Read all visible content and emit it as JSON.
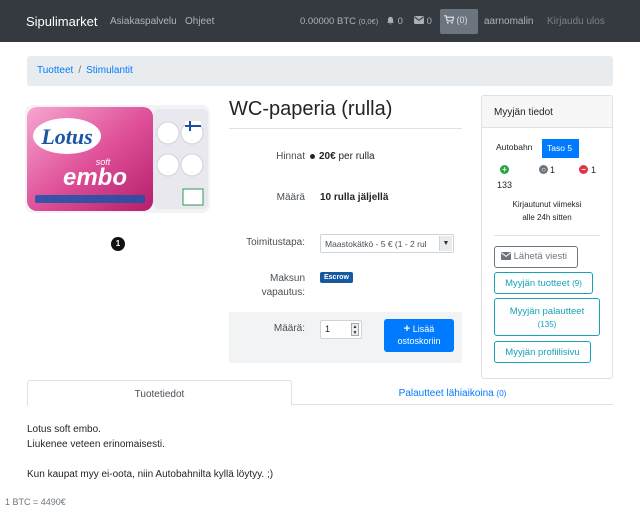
{
  "navbar": {
    "brand": "Sipulimarket",
    "links": [
      "Asiakaspalvelu",
      "Ohjeet"
    ],
    "balance": "0.00000 BTC",
    "balance_eur": "(0,0€)",
    "notifications": "0",
    "messages": "0",
    "cart_count": "(0)",
    "username": "aarnomalin",
    "logout": "Kirjaudu ulos",
    "icons": [
      "bell-icon",
      "envelope-icon",
      "cart-icon"
    ]
  },
  "breadcrumb": [
    "Tuotteet",
    "Stimulantit"
  ],
  "product": {
    "image_badge": "1",
    "title": "WC-paperia (rulla)",
    "price_label": "Hinnat",
    "price_value": "20€",
    "price_unit": "per rulla",
    "stock_label": "Määrä",
    "stock_value": "10 rulla jäljellä",
    "shipping_label": "Toimitustapa:",
    "shipping_selected": "Maastokätkö - 5 € (1 - 2 rul",
    "payment_label_1": "Maksun",
    "payment_label_2": "vapautus:",
    "payment_badge": "Escrow",
    "quantity_label": "Määrä:",
    "quantity_value": "1",
    "add_to_cart_1": "Lisää",
    "add_to_cart_2": "ostoskoriin",
    "image_text": {
      "brand": "Lotus",
      "sub1": "soft",
      "sub2": "embo"
    }
  },
  "seller": {
    "header": "Myyjän tiedot",
    "tab_1": "Autobahn",
    "tab_2": "Taso 5",
    "feedback_positive": "133",
    "feedback_neutral": "1",
    "feedback_negative": "1",
    "note_1": "Kirjautunut viimeksi",
    "note_2": "alle 24h sitten",
    "send_message": "Lähetä viesti",
    "products": "Myyjän tuotteet",
    "products_count": "(9)",
    "reviews": "Myyjän palautteet",
    "reviews_count": "(135)",
    "profile": "Myyjän profiilisivu",
    "colors": {
      "positive": "#28a745",
      "neutral": "#6c757d",
      "negative": "#dc3545"
    }
  },
  "tabs": {
    "details": "Tuotetiedot",
    "reviews": "Palautteet lähiaikoina",
    "reviews_count": "(0)"
  },
  "description": [
    "Lotus soft embo.",
    "Liukenee veteen erinomaisesti.",
    "Kun kaupat myy ei-oota, niin Autobahnilta kyllä löytyy. ;)"
  ],
  "footer": "1 BTC = 4490€"
}
